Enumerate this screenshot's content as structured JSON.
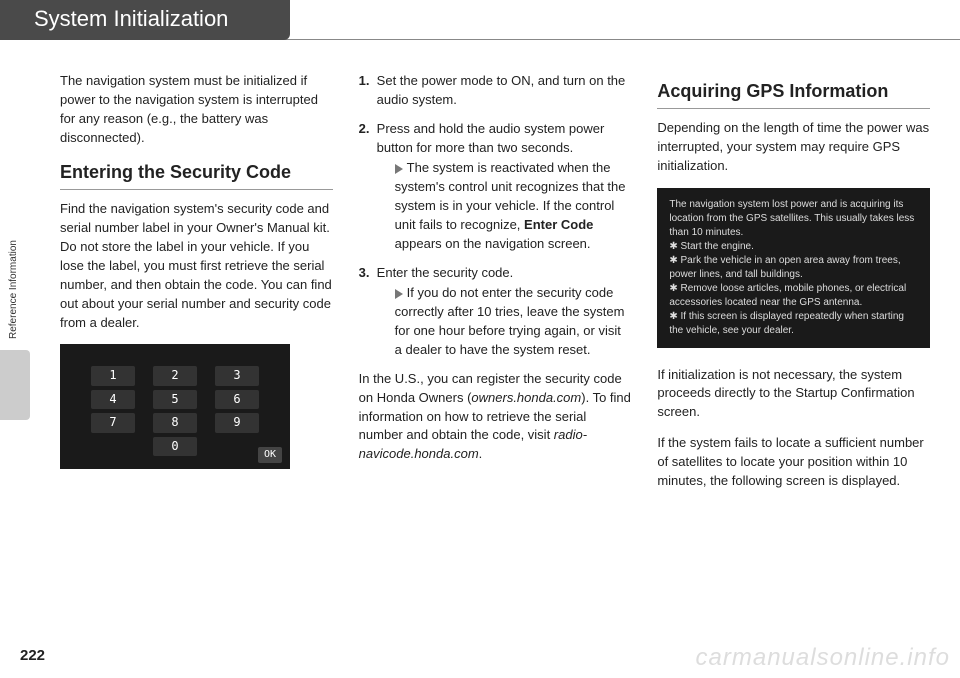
{
  "header": {
    "title": "System Initialization"
  },
  "side": {
    "label": "Reference Information"
  },
  "col1": {
    "intro": "The navigation system must be initialized if power to the navigation system is interrupted for any reason (e.g., the battery was disconnected).",
    "h2": "Entering the Security Code",
    "p1": "Find the navigation system's security code and serial number label in your Owner's Manual kit. Do not store the label in your vehicle. If you lose the label, you must first retrieve the serial number, and then obtain the code. You can find out about your serial number and security code from a dealer.",
    "keypad": {
      "keys": [
        "1",
        "2",
        "3",
        "4",
        "5",
        "6",
        "7",
        "8",
        "9",
        "0"
      ],
      "ok": "OK"
    }
  },
  "col2": {
    "steps": {
      "s1": "Set the power mode to ON, and turn on the audio system.",
      "s2": "Press and hold the audio system power button for more than two seconds.",
      "s2sub_a": "The system is reactivated when the system's control unit recognizes that the system is in your vehicle. If the control unit fails to recognize, ",
      "s2sub_bold": "Enter Code",
      "s2sub_b": " appears on the navigation screen.",
      "s3": "Enter the security code.",
      "s3sub": "If you do not enter the security code correctly after 10 tries, leave the system for one hour before trying again, or visit a dealer to have the system reset."
    },
    "p1a": "In the U.S., you can register the security code on Honda Owners (",
    "p1em1": "owners.honda.com",
    "p1b": "). To find information on how to retrieve the serial number and obtain the code, visit ",
    "p1em2": "radio-navicode.honda.com",
    "p1c": "."
  },
  "col3": {
    "h2": "Acquiring GPS Information",
    "p1": "Depending on the length of time the power was interrupted, your system may require GPS initialization.",
    "gps": {
      "l1": "The navigation system lost power and is acquiring its location from the GPS satellites. This usually takes less than 10 minutes.",
      "l2": "✱ Start the engine.",
      "l3": "✱ Park the vehicle in an open area away from trees, power lines, and tall buildings.",
      "l4": "✱ Remove loose articles, mobile phones, or electrical accessories located near the GPS antenna.",
      "l5": "✱ If this screen is displayed repeatedly when starting the vehicle, see your dealer."
    },
    "p2": "If initialization is not necessary, the system proceeds directly to the Startup Confirmation screen.",
    "p3": "If the system fails to locate a sufficient number of satellites to locate your position within 10 minutes, the following screen is displayed."
  },
  "footer": {
    "page": "222",
    "watermark": "carmanualsonline.info"
  }
}
